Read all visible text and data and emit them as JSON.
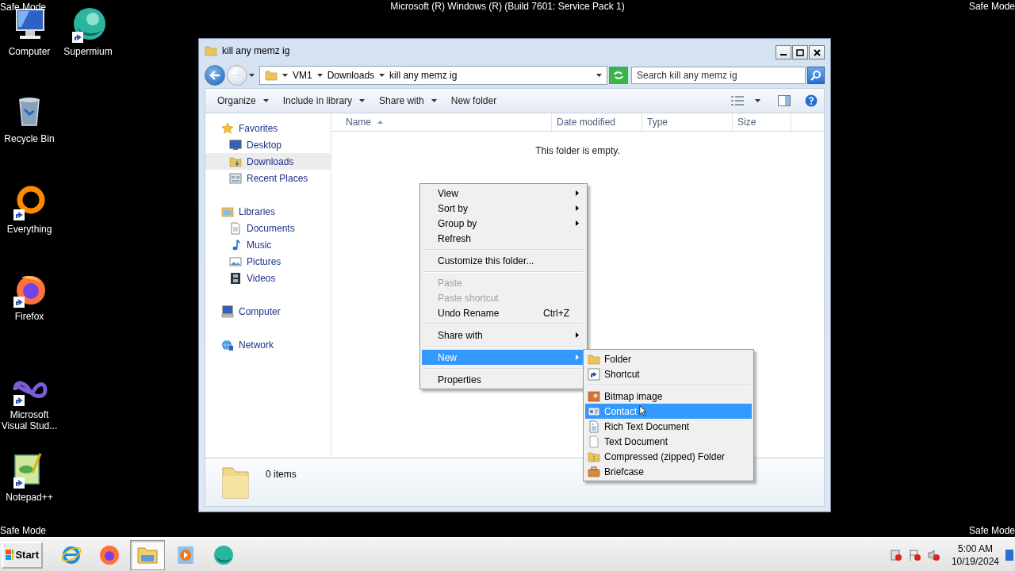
{
  "desktop": {
    "top_left": "Safe Mode",
    "top_center": "Microsoft (R) Windows (R) (Build 7601: Service Pack 1)",
    "top_right": "Safe Mode",
    "bottom_left": "Safe Mode",
    "bottom_right": "Safe Mode",
    "icons": [
      {
        "label": "Computer",
        "kind": "computer",
        "shortcut": false
      },
      {
        "label": "Supermium",
        "kind": "sphere",
        "shortcut": true
      },
      {
        "label": "Recycle Bin",
        "kind": "trash",
        "shortcut": false
      },
      {
        "label": "Everything",
        "kind": "ring",
        "shortcut": true
      },
      {
        "label": "Firefox",
        "kind": "firefox",
        "shortcut": true
      },
      {
        "label": "Microsoft Visual Stud...",
        "kind": "infinity",
        "shortcut": true
      },
      {
        "label": "Notepad++",
        "kind": "notepad",
        "shortcut": true
      }
    ]
  },
  "window": {
    "title": "kill any memz ig",
    "address": {
      "segments": [
        "VM1",
        "Downloads",
        "kill any memz ig"
      ]
    },
    "search": {
      "placeholder": "Search kill any memz ig"
    },
    "toolbar": [
      {
        "label": "Organize",
        "dropdown": true
      },
      {
        "label": "Include in library",
        "dropdown": true
      },
      {
        "label": "Share with",
        "dropdown": true
      },
      {
        "label": "New folder",
        "dropdown": false
      }
    ],
    "nav": [
      {
        "label": "Favorites",
        "kind": "star",
        "selected": false,
        "children": [
          {
            "label": "Desktop",
            "kind": "desktop",
            "selected": false
          },
          {
            "label": "Downloads",
            "kind": "downloads",
            "selected": true
          },
          {
            "label": "Recent Places",
            "kind": "recent",
            "selected": false
          }
        ]
      },
      {
        "label": "Libraries",
        "kind": "library",
        "selected": false,
        "children": [
          {
            "label": "Documents",
            "kind": "documents",
            "selected": false
          },
          {
            "label": "Music",
            "kind": "music",
            "selected": false
          },
          {
            "label": "Pictures",
            "kind": "pictures",
            "selected": false
          },
          {
            "label": "Videos",
            "kind": "videos",
            "selected": false
          }
        ]
      },
      {
        "label": "Computer",
        "kind": "computer",
        "selected": false
      },
      {
        "label": "Network",
        "kind": "network",
        "selected": false
      }
    ],
    "columns": [
      {
        "label": "Name",
        "sorted": true
      },
      {
        "label": "Date modified",
        "sorted": false
      },
      {
        "label": "Type",
        "sorted": false
      },
      {
        "label": "Size",
        "sorted": false
      }
    ],
    "empty_message": "This folder is empty.",
    "details": {
      "count": "0 items"
    }
  },
  "context_menu": {
    "items": [
      {
        "kind": "item",
        "label": "View",
        "submenu": true,
        "disabled": false,
        "selected": false
      },
      {
        "kind": "item",
        "label": "Sort by",
        "submenu": true,
        "disabled": false,
        "selected": false
      },
      {
        "kind": "item",
        "label": "Group by",
        "submenu": true,
        "disabled": false,
        "selected": false
      },
      {
        "kind": "item",
        "label": "Refresh",
        "submenu": false,
        "disabled": false,
        "selected": false
      },
      {
        "kind": "separator"
      },
      {
        "kind": "item",
        "label": "Customize this folder...",
        "submenu": false,
        "disabled": false,
        "selected": false
      },
      {
        "kind": "separator"
      },
      {
        "kind": "item",
        "label": "Paste",
        "submenu": false,
        "disabled": true,
        "selected": false
      },
      {
        "kind": "item",
        "label": "Paste shortcut",
        "submenu": false,
        "disabled": true,
        "selected": false
      },
      {
        "kind": "item",
        "label": "Undo Rename",
        "accelerator": "Ctrl+Z",
        "submenu": false,
        "disabled": false,
        "selected": false
      },
      {
        "kind": "separator"
      },
      {
        "kind": "item",
        "label": "Share with",
        "submenu": true,
        "disabled": false,
        "selected": false
      },
      {
        "kind": "separator"
      },
      {
        "kind": "item",
        "label": "New",
        "submenu": true,
        "disabled": false,
        "selected": true
      },
      {
        "kind": "separator"
      },
      {
        "kind": "item",
        "label": "Properties",
        "submenu": false,
        "disabled": false,
        "selected": false
      }
    ]
  },
  "new_submenu": {
    "items": [
      {
        "kind": "folder",
        "label": "Folder",
        "selected": false
      },
      {
        "kind": "shortcut",
        "label": "Shortcut",
        "selected": false
      },
      {
        "kind": "separator"
      },
      {
        "kind": "bitmap",
        "label": "Bitmap image",
        "selected": false
      },
      {
        "kind": "contact",
        "label": "Contact",
        "selected": true
      },
      {
        "kind": "rtf",
        "label": "Rich Text Document",
        "selected": false
      },
      {
        "kind": "text",
        "label": "Text Document",
        "selected": false
      },
      {
        "kind": "zip",
        "label": "Compressed (zipped) Folder",
        "selected": false
      },
      {
        "kind": "briefcase",
        "label": "Briefcase",
        "selected": false
      }
    ]
  },
  "taskbar": {
    "start": "Start",
    "apps": [
      {
        "kind": "ie",
        "selected": false
      },
      {
        "kind": "firefox",
        "selected": false
      },
      {
        "kind": "explorer",
        "selected": true
      },
      {
        "kind": "media",
        "selected": false
      },
      {
        "kind": "sphere",
        "selected": false
      }
    ],
    "clock": {
      "time": "5:00 AM",
      "date": "10/19/2024"
    }
  }
}
